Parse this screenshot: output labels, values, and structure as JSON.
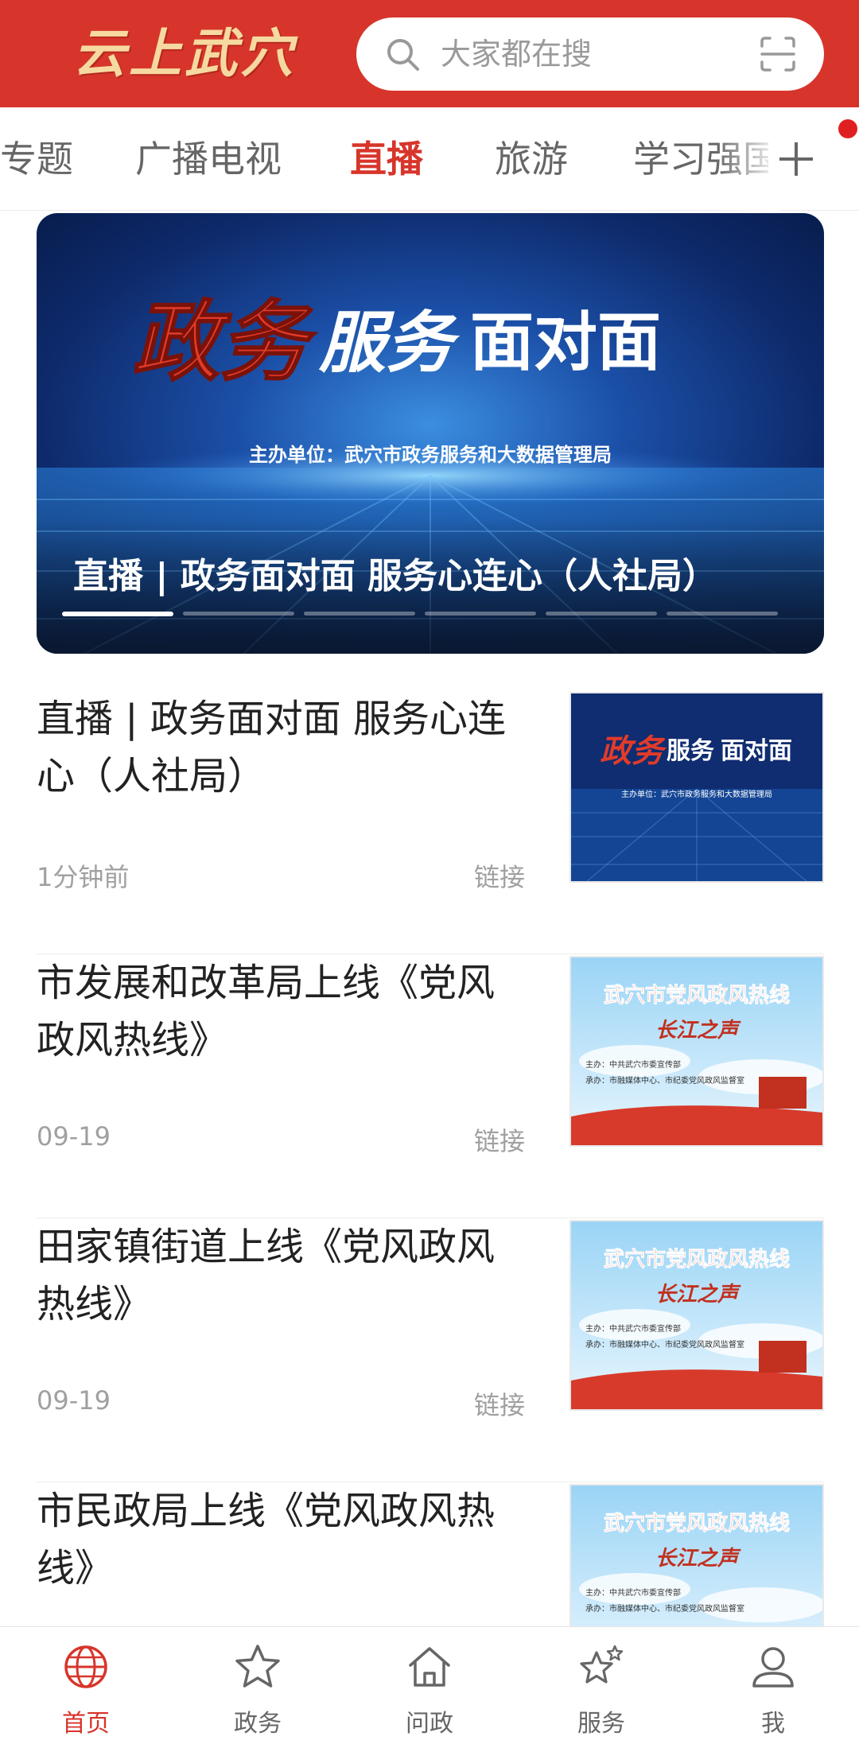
{
  "colors": {
    "brand": "#d7352b",
    "header_bg": "#d7352b",
    "logo": "#f6d9a0",
    "muted": "#a0a0a0"
  },
  "header": {
    "logo": "云上武穴",
    "search_placeholder": "大家都在搜",
    "search_icon": "search-icon",
    "scan_icon": "scan-icon"
  },
  "tabs": {
    "items": [
      "专题",
      "广播电视",
      "直播",
      "旅游",
      "学习强国"
    ],
    "active": "直播",
    "more_icon": "plus-icon"
  },
  "banner": {
    "poster_title_red": "政务",
    "poster_title_white": "服务",
    "poster_title_block": "面对面",
    "poster_subtitle": "主办单位：武穴市政务服务和大数据管理局",
    "caption": "直播 | 政务面对面 服务心连心（人社局）",
    "slide_count": 6,
    "active_slide": 1
  },
  "news": [
    {
      "title": "直播 | 政务面对面 服务心连心（人社局）",
      "time": "1分钟前",
      "tag": "链接",
      "thumb": {
        "type": "blue",
        "t1": "政务",
        "t2": "服务",
        "t3": "面对面",
        "sub": "主办单位：武穴市政务服务和大数据管理局"
      }
    },
    {
      "title": "市发展和改革局上线《党风政风热线》",
      "time": "09-19",
      "tag": "链接",
      "thumb": {
        "type": "sky",
        "t1": "武穴市党风政风热线",
        "t2": "长江之声",
        "l1": "主办：中共武穴市委宣传部",
        "l2": "承办：市融媒体中心、市纪委党风政风监督室"
      }
    },
    {
      "title": "田家镇街道上线《党风政风热线》",
      "time": "09-19",
      "tag": "链接",
      "thumb": {
        "type": "sky",
        "t1": "武穴市党风政风热线",
        "t2": "长江之声",
        "l1": "主办：中共武穴市委宣传部",
        "l2": "承办：市融媒体中心、市纪委党风政风监督室"
      }
    },
    {
      "title": "市民政局上线《党风政风热线》",
      "time": "",
      "tag": "",
      "thumb": {
        "type": "sky",
        "t1": "武穴市党风政风热线",
        "t2": "长江之声",
        "l1": "主办：中共武穴市委宣传部",
        "l2": "承办：市融媒体中心、市纪委党风政风监督室"
      }
    }
  ],
  "bottom_nav": {
    "items": [
      {
        "label": "首页",
        "icon": "globe-icon"
      },
      {
        "label": "政务",
        "icon": "star-icon"
      },
      {
        "label": "问政",
        "icon": "home-icon"
      },
      {
        "label": "服务",
        "icon": "stars-icon"
      },
      {
        "label": "我",
        "icon": "user-icon"
      }
    ],
    "active": "首页"
  }
}
